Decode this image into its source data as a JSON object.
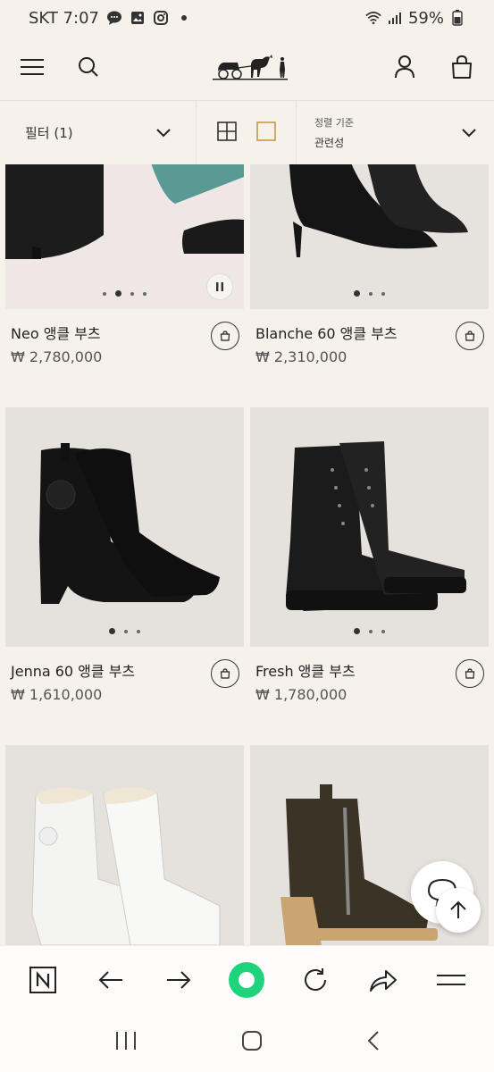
{
  "status_bar": {
    "carrier_time": "SKT 7:07",
    "battery": "59%",
    "notification_icons": [
      "chat-icon",
      "gallery-icon",
      "instagram-icon",
      "dot-icon"
    ]
  },
  "header": {
    "menu_icon": "hamburger-icon",
    "search_icon": "search-icon",
    "logo_icon": "hermes-carriage-logo",
    "account_icon": "user-icon",
    "cart_icon": "shopping-bag-icon"
  },
  "toolbar": {
    "filter_label": "필터 (1)",
    "sort_caption": "정렬 기준",
    "sort_value": "관련성"
  },
  "products": [
    {
      "name": "Neo 앵클 부츠",
      "price": "₩ 2,780,000",
      "slides": 4,
      "active_slide": 2
    },
    {
      "name": "Blanche 60 앵클 부츠",
      "price": "₩ 2,310,000",
      "slides": 3,
      "active_slide": 1
    },
    {
      "name": "Jenna 60 앵클 부츠",
      "price": "₩ 1,610,000",
      "slides": 3,
      "active_slide": 1
    },
    {
      "name": "Fresh 앵클 부츠",
      "price": "₩ 1,780,000",
      "slides": 3,
      "active_slide": 1
    }
  ],
  "colors": {
    "background": "#f6f1eb",
    "image_background": "#e7e2de",
    "accent_green": "#1fd37a",
    "text": "#222222"
  },
  "browser_bar": {
    "icons": [
      "naver-n-icon",
      "back-arrow-icon",
      "forward-arrow-icon",
      "green-home-icon",
      "reload-icon",
      "share-icon",
      "menu-icon"
    ]
  },
  "system_nav": {
    "icons": [
      "recents-icon",
      "home-icon",
      "back-icon"
    ]
  }
}
